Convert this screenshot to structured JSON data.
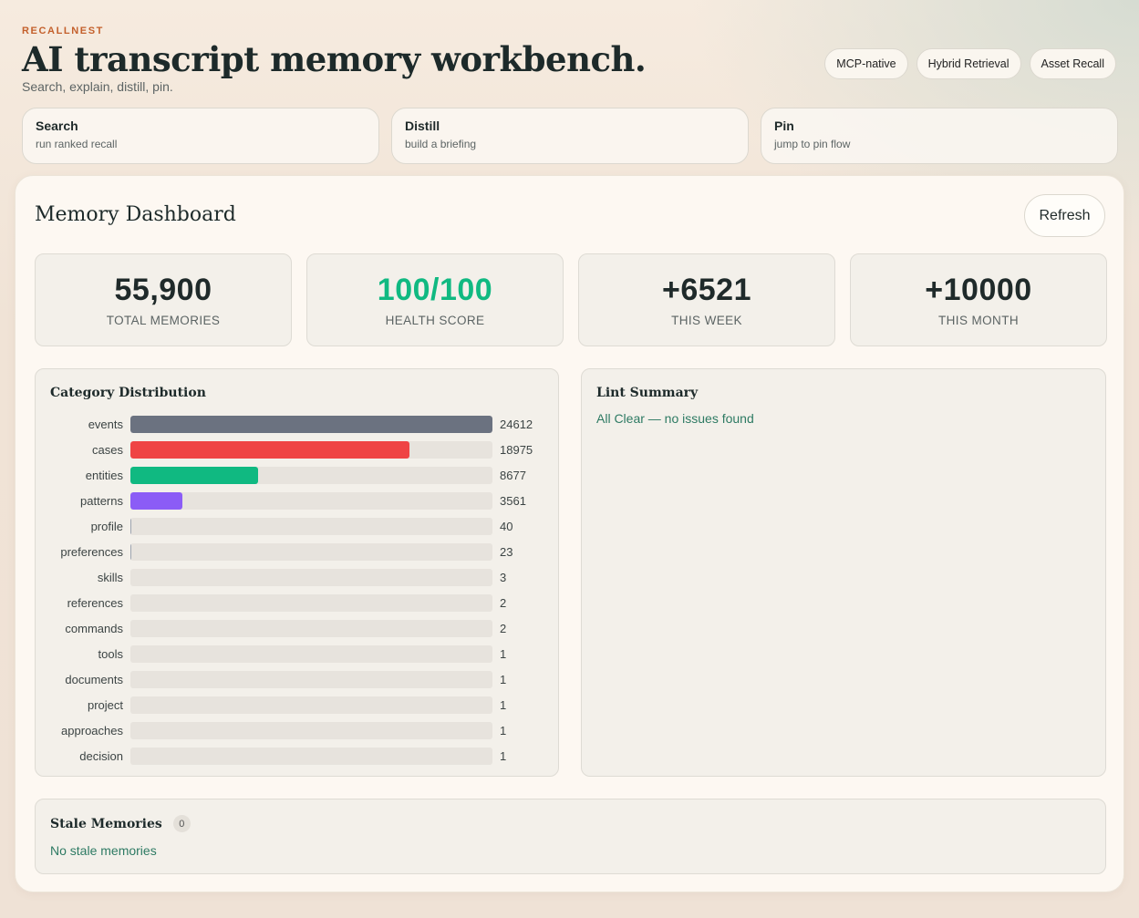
{
  "header": {
    "brand": "RECALLNEST",
    "title": "AI transcript memory workbench.",
    "tagline": "Search, explain, distill, pin.",
    "chips": [
      "MCP-native",
      "Hybrid Retrieval",
      "Asset Recall"
    ]
  },
  "quick_actions": [
    {
      "title": "Search",
      "subtitle": "run ranked recall"
    },
    {
      "title": "Distill",
      "subtitle": "build a briefing"
    },
    {
      "title": "Pin",
      "subtitle": "jump to pin flow"
    }
  ],
  "dashboard": {
    "title": "Memory Dashboard",
    "refresh_label": "Refresh",
    "stats": [
      {
        "value": "55,900",
        "label": "TOTAL MEMORIES"
      },
      {
        "value": "100/100",
        "label": "HEALTH SCORE"
      },
      {
        "value": "+6521",
        "label": "THIS WEEK"
      },
      {
        "value": "+10000",
        "label": "THIS MONTH"
      }
    ],
    "category_title": "Category Distribution",
    "lint": {
      "title": "Lint Summary",
      "message": "All Clear — no issues found"
    },
    "stale": {
      "title": "Stale Memories",
      "count": "0",
      "message": "No stale memories"
    }
  },
  "colors": {
    "brand": "#c4602c",
    "health_good": "#10b981",
    "ok_text": "#2d7a63",
    "events": "#6b7280",
    "cases": "#ef4444",
    "entities": "#10b981",
    "patterns": "#8b5cf6"
  },
  "chart_data": {
    "type": "bar",
    "orientation": "horizontal",
    "title": "Category Distribution",
    "categories": [
      "events",
      "cases",
      "entities",
      "patterns",
      "profile",
      "preferences",
      "skills",
      "references",
      "commands",
      "tools",
      "documents",
      "project",
      "approaches",
      "decision"
    ],
    "values": [
      24612,
      18975,
      8677,
      3561,
      40,
      23,
      3,
      2,
      2,
      1,
      1,
      1,
      1,
      1
    ],
    "bar_colors": [
      "#6b7280",
      "#ef4444",
      "#10b981",
      "#8b5cf6",
      "#9ca3af",
      "#9ca3af",
      "#9ca3af",
      "#9ca3af",
      "#9ca3af",
      "#9ca3af",
      "#9ca3af",
      "#9ca3af",
      "#9ca3af",
      "#9ca3af"
    ],
    "xlim": [
      0,
      24612
    ]
  }
}
